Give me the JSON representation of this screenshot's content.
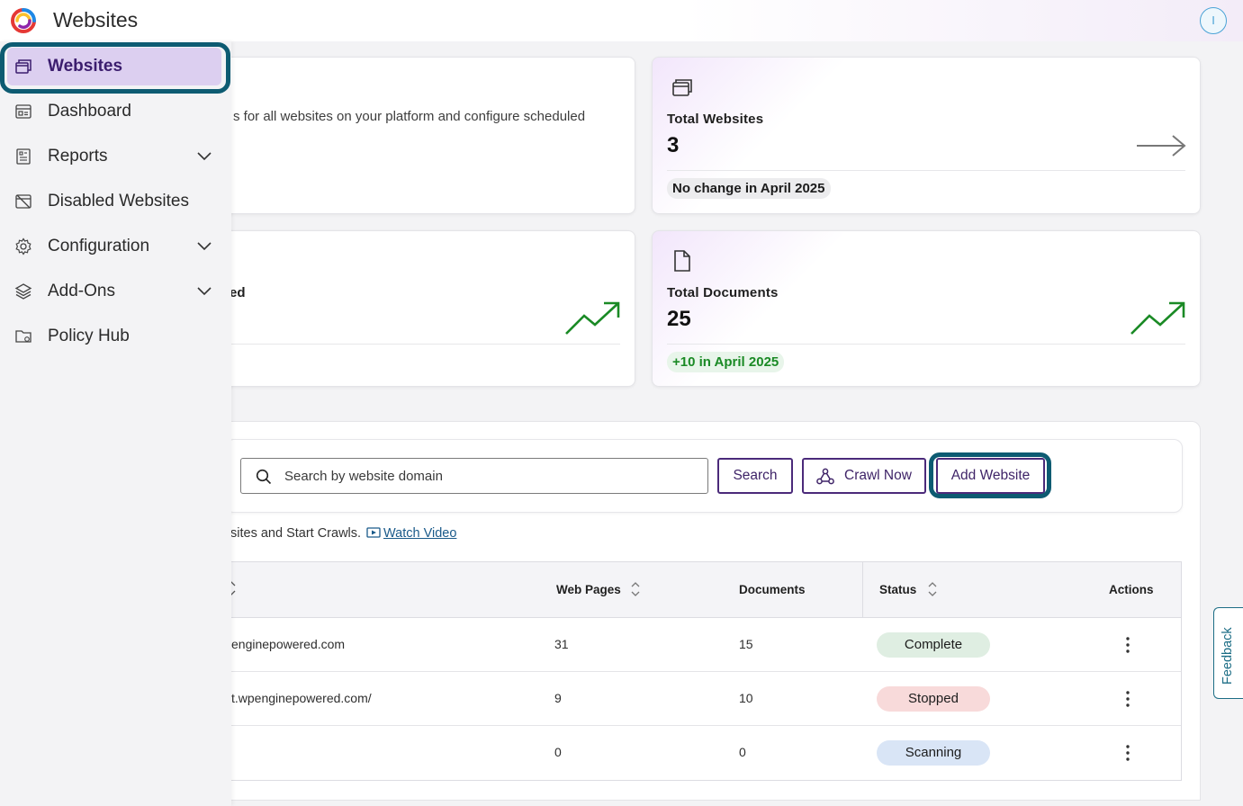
{
  "header": {
    "title": "Websites",
    "user_initial": "I"
  },
  "sidebar": {
    "items": [
      {
        "label": "Websites",
        "icon": "websites-icon",
        "active": true
      },
      {
        "label": "Dashboard",
        "icon": "dashboard-icon"
      },
      {
        "label": "Reports",
        "icon": "reports-icon",
        "expandable": true
      },
      {
        "label": "Disabled Websites",
        "icon": "disabled-websites-icon"
      },
      {
        "label": "Configuration",
        "icon": "gear-icon",
        "expandable": true
      },
      {
        "label": "Add-Ons",
        "icon": "layers-icon",
        "expandable": true
      },
      {
        "label": "Policy Hub",
        "icon": "policy-folder-icon"
      }
    ]
  },
  "intro": {
    "text": "s for all websites on your platform and configure scheduled"
  },
  "second_card": {
    "partial_label": "ed"
  },
  "stats": {
    "total_websites": {
      "label": "Total Websites",
      "value": "3",
      "badge": "No change in April 2025"
    },
    "total_documents": {
      "label": "Total Documents",
      "value": "25",
      "badge": "+10 in April 2025"
    }
  },
  "toolbar": {
    "search_placeholder": "Search by website domain",
    "search_label": "Search",
    "crawl_label": "Crawl Now",
    "add_label": "Add Website"
  },
  "helper": {
    "text": "sites and Start Crawls.",
    "video_link": "Watch Video"
  },
  "table": {
    "headers": {
      "web_pages": "Web Pages",
      "documents": "Documents",
      "status": "Status",
      "actions": "Actions"
    },
    "rows": [
      {
        "domain": "enginepowered.com",
        "web_pages": "31",
        "documents": "15",
        "status": "Complete"
      },
      {
        "domain": "t.wpenginepowered.com/",
        "web_pages": "9",
        "documents": "10",
        "status": "Stopped"
      },
      {
        "domain": "",
        "web_pages": "0",
        "documents": "0",
        "status": "Scanning"
      }
    ]
  },
  "feedback": {
    "label": "Feedback"
  },
  "colors": {
    "accent": "#4b2a7a",
    "highlight": "#0d5b72",
    "positive": "#1a8a25"
  }
}
